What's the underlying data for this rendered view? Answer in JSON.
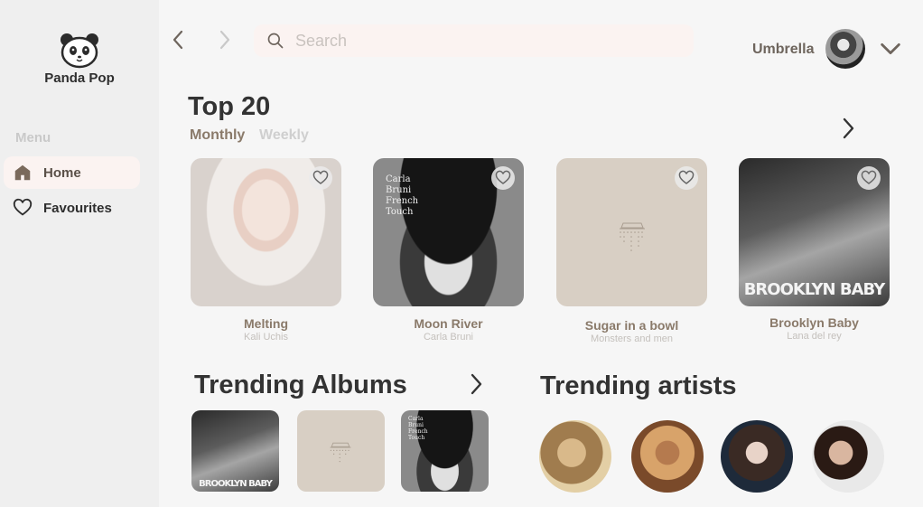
{
  "app": {
    "name": "Panda Pop"
  },
  "sidebar": {
    "menu_label": "Menu",
    "items": [
      {
        "label": "Home",
        "icon": "home-icon",
        "active": true
      },
      {
        "label": "Favourites",
        "icon": "heart-icon",
        "active": false
      }
    ]
  },
  "header": {
    "search_placeholder": "Search",
    "user_name": "Umbrella"
  },
  "top20": {
    "title": "Top 20",
    "tabs": [
      {
        "label": "Monthly",
        "active": true
      },
      {
        "label": "Weekly",
        "active": false
      }
    ],
    "cards": [
      {
        "title": "Melting",
        "artist": "Kali Uchis"
      },
      {
        "title": "Moon River",
        "artist": "Carla Bruni",
        "cover_text": [
          "Carla",
          "Bruni",
          "French",
          "Touch"
        ]
      },
      {
        "title": "Sugar in a bowl",
        "artist": "Monsters and men"
      },
      {
        "title": "Brooklyn Baby",
        "artist": "Lana del rey",
        "cover_text": "BROOKLYN BABY"
      }
    ]
  },
  "trending_albums": {
    "title": "Trending Albums",
    "albums": [
      {
        "cover_text": "BROOKLYN BABY"
      },
      {
        "cover_text": ""
      },
      {
        "cover_text": [
          "Carla",
          "Bruni",
          "French",
          "Touch"
        ]
      }
    ]
  },
  "trending_artists": {
    "title": "Trending artists"
  },
  "colors": {
    "accent": "#8a7a6a",
    "active_bg": "#fbf3f1",
    "sidebar_bg": "#efefef",
    "page_bg": "#f6f6f6"
  }
}
